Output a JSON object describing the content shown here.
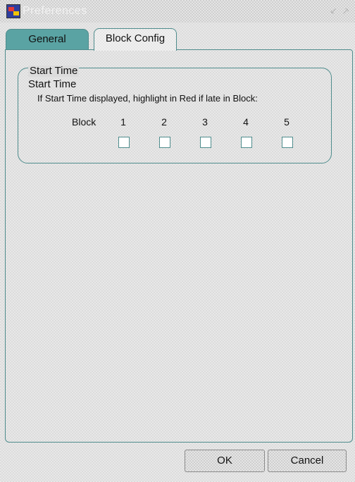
{
  "window": {
    "title": "Preferences",
    "minimize_glyph": "⸔",
    "maximize_glyph": "⸕"
  },
  "tabs": [
    {
      "label": "General",
      "active": false
    },
    {
      "label": "Block Config",
      "active": true
    }
  ],
  "group": {
    "legend": "Start Time",
    "subtitle": "Start Time",
    "description": "If Start Time displayed, highlight in Red if late in Block:",
    "row_label": "Block",
    "blocks": [
      {
        "number": "1",
        "checked": false
      },
      {
        "number": "2",
        "checked": false
      },
      {
        "number": "3",
        "checked": false
      },
      {
        "number": "4",
        "checked": false
      },
      {
        "number": "5",
        "checked": false
      }
    ]
  },
  "buttons": {
    "ok": "OK",
    "cancel": "Cancel"
  },
  "colors": {
    "accent": "#5aa3a3",
    "border": "#4e8c8c"
  }
}
